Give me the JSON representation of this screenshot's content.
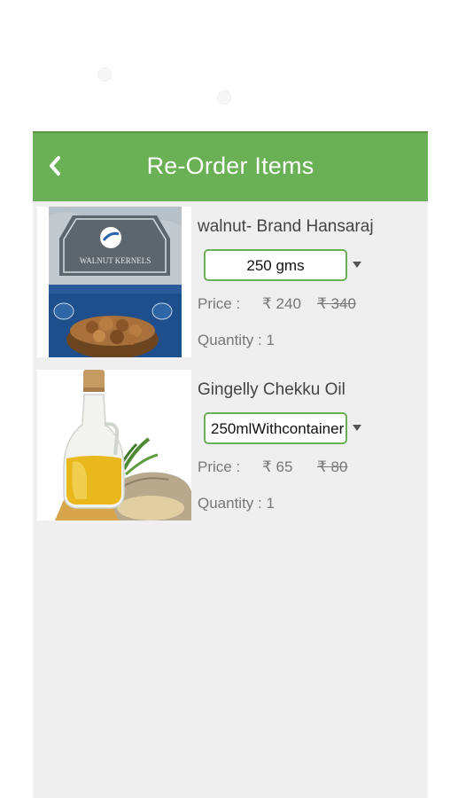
{
  "header": {
    "title": "Re-Order Items",
    "back_icon": "chevron-left-icon"
  },
  "colors": {
    "accent": "#6ab055",
    "background": "#efefef"
  },
  "items": [
    {
      "name": "walnut- Brand Hansaraj",
      "variant": "250 gms",
      "price_label": "Price :",
      "price": "₹ 240",
      "original_price": "₹ 340",
      "quantity": "Quantity : 1",
      "image_icon": "walnut-package-image"
    },
    {
      "name": "Gingelly Chekku Oil",
      "variant": "250mlWithcontainer",
      "price_label": "Price :",
      "price": "₹ 65",
      "original_price": "₹ 80",
      "quantity": "Quantity : 1",
      "image_icon": "oil-bottle-image"
    }
  ]
}
